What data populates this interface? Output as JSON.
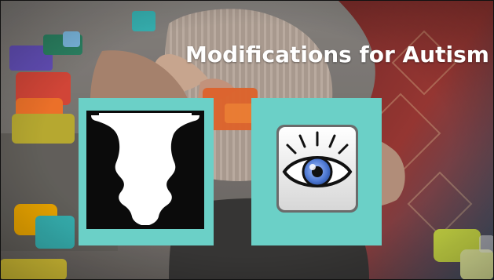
{
  "slide": {
    "title": "Modifications for Autism"
  },
  "colors": {
    "panel": "#6bd0c7",
    "title": "#ffffff",
    "bg_dark": "#161413",
    "eye_iris": "#4d78d2"
  },
  "icons": {
    "left": "rubin-vase-faces-icon",
    "right": "eye-icon"
  }
}
